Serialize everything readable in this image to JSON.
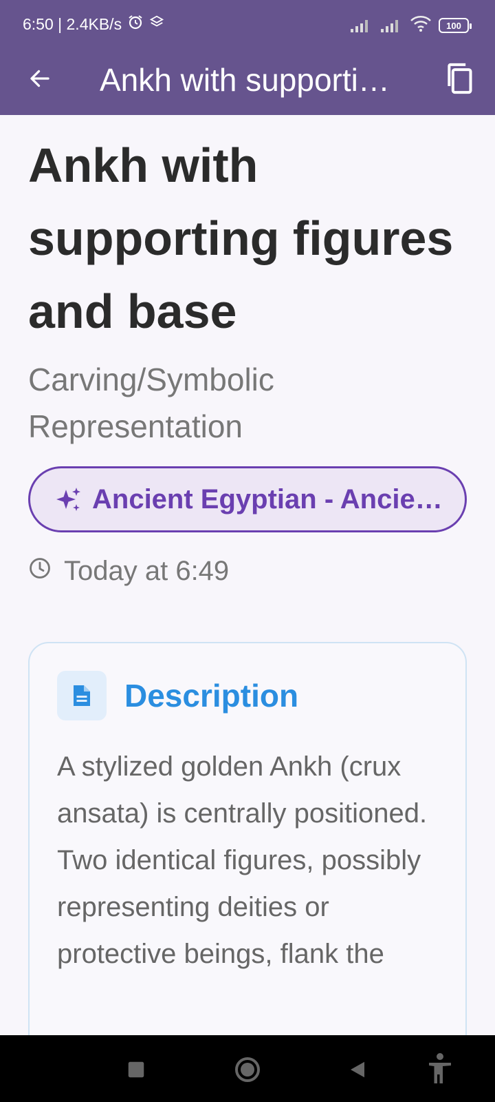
{
  "status_bar": {
    "time_speed": "6:50 | 2.4KB/s",
    "battery": "100"
  },
  "app_bar": {
    "title": "Ankh with supporti…"
  },
  "main": {
    "title": "Ankh with supporting figures and base",
    "subtitle": "Carving/Symbolic Representation",
    "chip_label": "Ancient Egyptian - Ancie…",
    "timestamp": "Today at 6:49",
    "card": {
      "title": "Description",
      "body": "A stylized golden Ankh (crux ansata) is centrally positioned.  Two identical figures, possibly representing deities or protective beings, flank the"
    }
  },
  "icons": {
    "back": "arrow-back-icon",
    "copy": "copy-icon",
    "sparkle": "sparkle-icon",
    "clock": "clock-icon",
    "document": "document-icon"
  },
  "colors": {
    "app_bar": "#66548e",
    "chip_accent": "#6a3fb0",
    "card_title": "#2b8ee0"
  }
}
